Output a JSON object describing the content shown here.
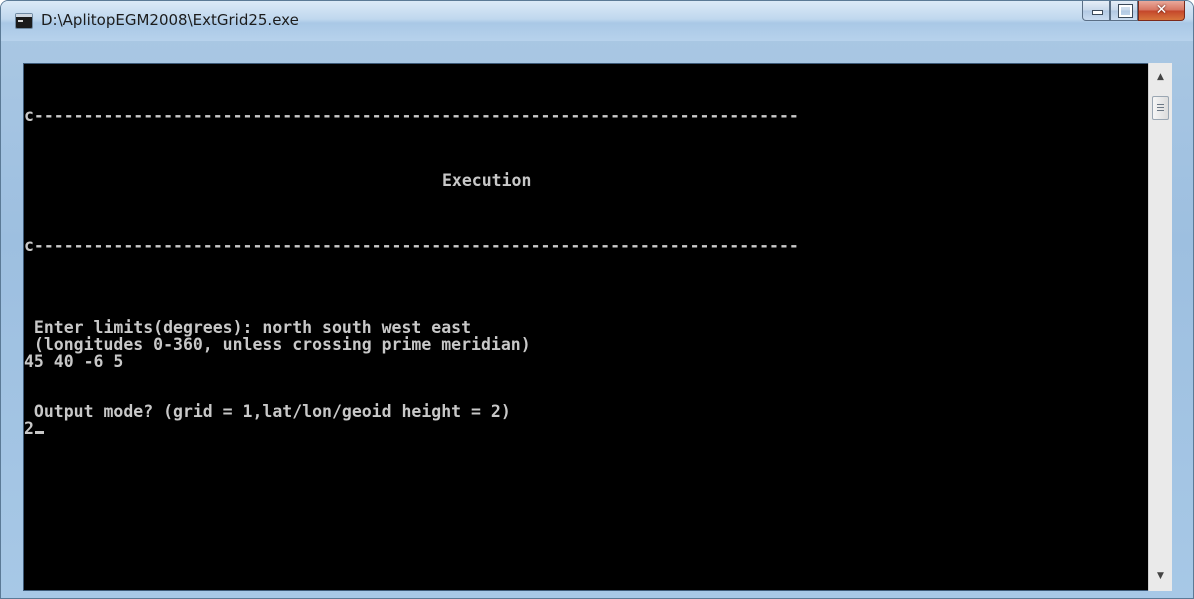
{
  "window": {
    "title": "D:\\AplitopEGM2008\\ExtGrid25.exe",
    "controls": {
      "minimize_icon": "minimize-icon",
      "maximize_icon": "maximize-icon",
      "close_icon": "close-icon",
      "close_glyph": "✕"
    }
  },
  "console": {
    "separator_1": "c-----------------------------------------------------------------------------",
    "heading": "Execution",
    "separator_2": "c-----------------------------------------------------------------------------",
    "prompt_limits": " Enter limits(degrees): north south west east",
    "prompt_limits_note": " (longitudes 0-360, unless crossing prime meridian)",
    "input_limits": "45 40 -6 5",
    "prompt_output_mode": " Output mode? (grid = 1,lat/lon/geoid height = 2)",
    "input_output_mode": "2"
  },
  "scrollbar": {
    "up_arrow": "▲",
    "down_arrow": "▼"
  },
  "colors": {
    "console_bg": "#000000",
    "console_text": "#c8c8c8",
    "frame": "#a9c8e6",
    "close_button": "#c4462b"
  }
}
